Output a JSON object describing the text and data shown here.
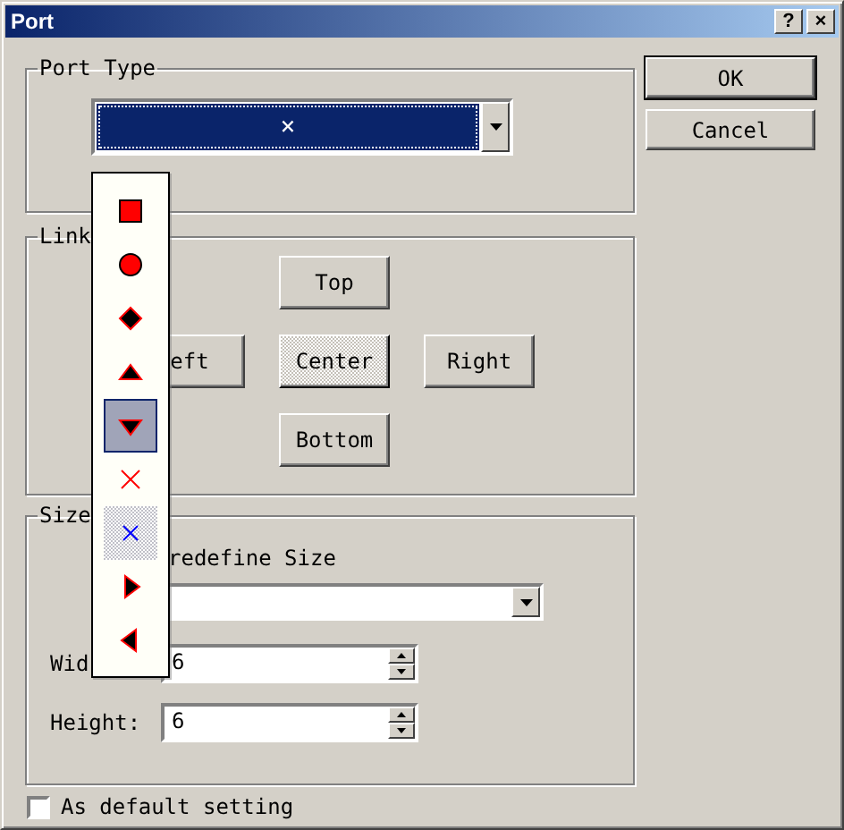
{
  "window": {
    "title": "Port",
    "title_buttons": [
      "?",
      "×"
    ]
  },
  "port_type": {
    "label": "Port Type",
    "combo": {
      "value": "×",
      "focused": true
    }
  },
  "dropdown": {
    "items": [
      {
        "kind": "square",
        "selected": false,
        "current": false
      },
      {
        "kind": "circle",
        "selected": false,
        "current": false
      },
      {
        "kind": "diamond",
        "selected": false,
        "current": false
      },
      {
        "kind": "up",
        "selected": false,
        "current": false
      },
      {
        "kind": "down",
        "selected": true,
        "current": false
      },
      {
        "kind": "cross",
        "selected": false,
        "current": false
      },
      {
        "kind": "cross-blue",
        "selected": false,
        "current": true
      },
      {
        "kind": "right",
        "selected": false,
        "current": false
      },
      {
        "kind": "left",
        "selected": false,
        "current": false
      }
    ]
  },
  "link": {
    "label": "Link",
    "buttons": [
      {
        "label": "Top",
        "pressed": false
      },
      {
        "label": "eft",
        "pressed": false
      },
      {
        "label": "Center",
        "pressed": true
      },
      {
        "label": "Right",
        "pressed": false
      },
      {
        "label": "Bottom",
        "pressed": false
      }
    ]
  },
  "size": {
    "label": "Size",
    "predefine_label": "redefine Size",
    "fields": [
      {
        "label": "Wid",
        "value": "6"
      },
      {
        "label": "Height:",
        "value": "6"
      }
    ]
  },
  "default_setting": {
    "label": "As default setting",
    "checked": false
  },
  "buttons": [
    {
      "label": "OK",
      "default": true
    },
    {
      "label": "Cancel",
      "default": false
    }
  ]
}
